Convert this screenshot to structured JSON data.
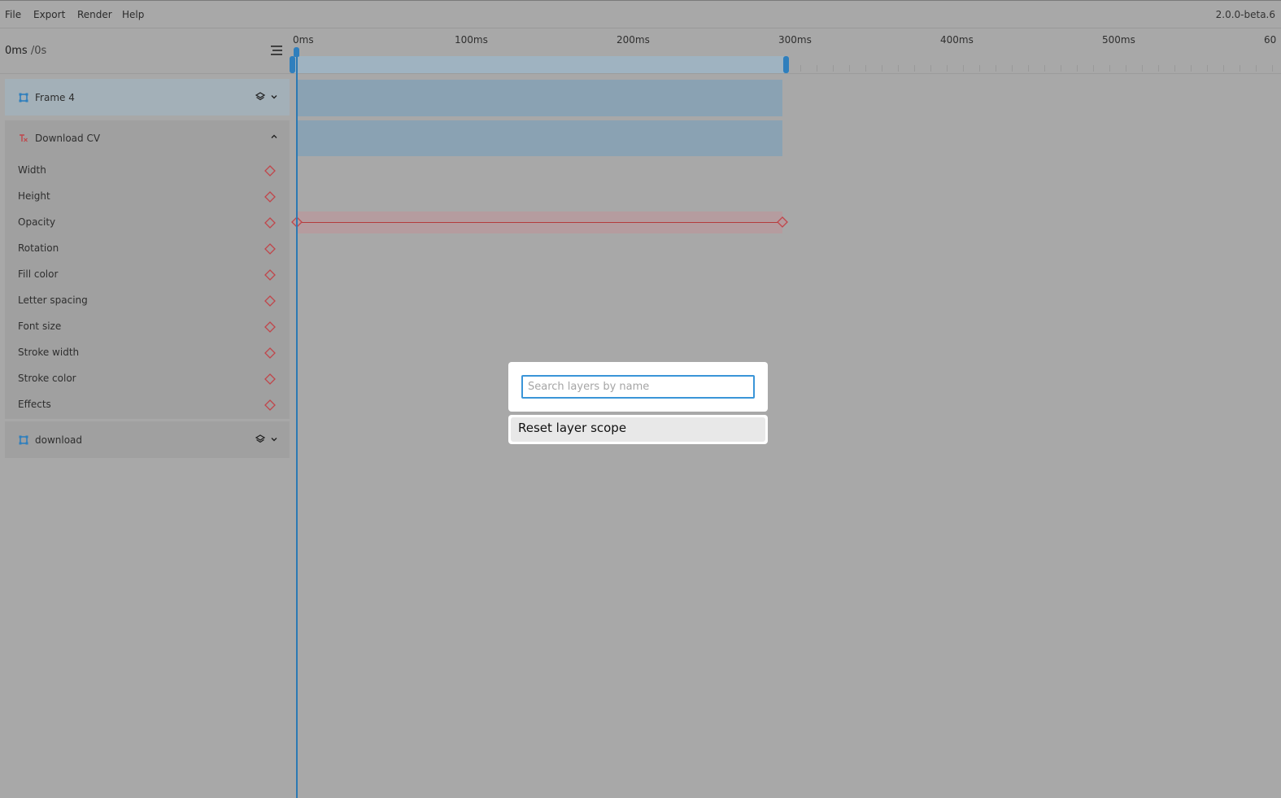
{
  "menu": {
    "items": [
      {
        "label": "File"
      },
      {
        "label": "Export"
      },
      {
        "label": "Render"
      },
      {
        "label": "Help"
      }
    ],
    "version": "2.0.0-beta.6"
  },
  "timebar": {
    "current": "0ms",
    "total": " /0s"
  },
  "ruler": {
    "labels": [
      "0ms",
      "100ms",
      "200ms",
      "300ms",
      "400ms",
      "500ms",
      "60"
    ]
  },
  "layers": {
    "frame4": {
      "name": "Frame 4",
      "icon": "frame-icon"
    },
    "text": {
      "name": "Download CV",
      "icon": "text-layer-icon"
    },
    "download": {
      "name": "download",
      "icon": "frame-icon"
    }
  },
  "properties": [
    "Width",
    "Height",
    "Opacity",
    "Rotation",
    "Fill color",
    "Letter spacing",
    "Font size",
    "Stroke width",
    "Stroke color",
    "Effects"
  ],
  "search": {
    "placeholder": "Search layers by name",
    "value": ""
  },
  "reset": {
    "label": "Reset layer scope"
  },
  "colors": {
    "accent": "#2f7fbd",
    "keyframe": "#c0464b",
    "track": "#8aa2b3",
    "opacity_track": "#b59c9f"
  }
}
